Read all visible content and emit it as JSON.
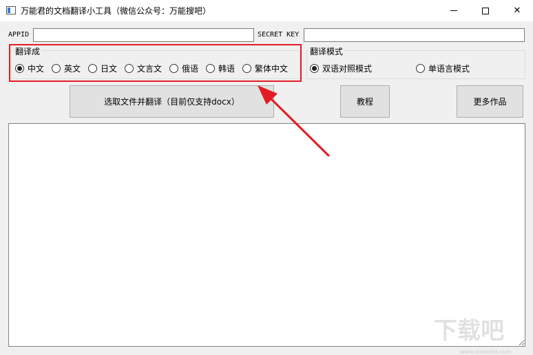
{
  "window": {
    "title": "万能君的文档翻译小工具（微信公众号：万能搜吧）",
    "min_glyph": "—",
    "max_glyph": "☐",
    "close_glyph": "✕"
  },
  "credentials": {
    "appid_label": "APPID",
    "appid_value": "",
    "secret_label": "SECRET KEY",
    "secret_value": ""
  },
  "translate_to": {
    "title": "翻译成",
    "options": [
      {
        "label": "中文",
        "selected": true
      },
      {
        "label": "英文",
        "selected": false
      },
      {
        "label": "日文",
        "selected": false
      },
      {
        "label": "文言文",
        "selected": false
      },
      {
        "label": "俄语",
        "selected": false
      },
      {
        "label": "韩语",
        "selected": false
      },
      {
        "label": "繁体中文",
        "selected": false
      }
    ]
  },
  "translate_mode": {
    "title": "翻译模式",
    "options": [
      {
        "label": "双语对照模式",
        "selected": true
      },
      {
        "label": "单语言模式",
        "selected": false
      }
    ]
  },
  "buttons": {
    "select_file": "选取文件并翻译（目前仅支持docx）",
    "tutorial": "教程",
    "more_works": "更多作品"
  },
  "output": {
    "content": ""
  },
  "annotation": {
    "highlight_color": "#e31b23"
  },
  "watermark": {
    "main": "下载吧",
    "sub": "www.xiazaiba.com"
  }
}
